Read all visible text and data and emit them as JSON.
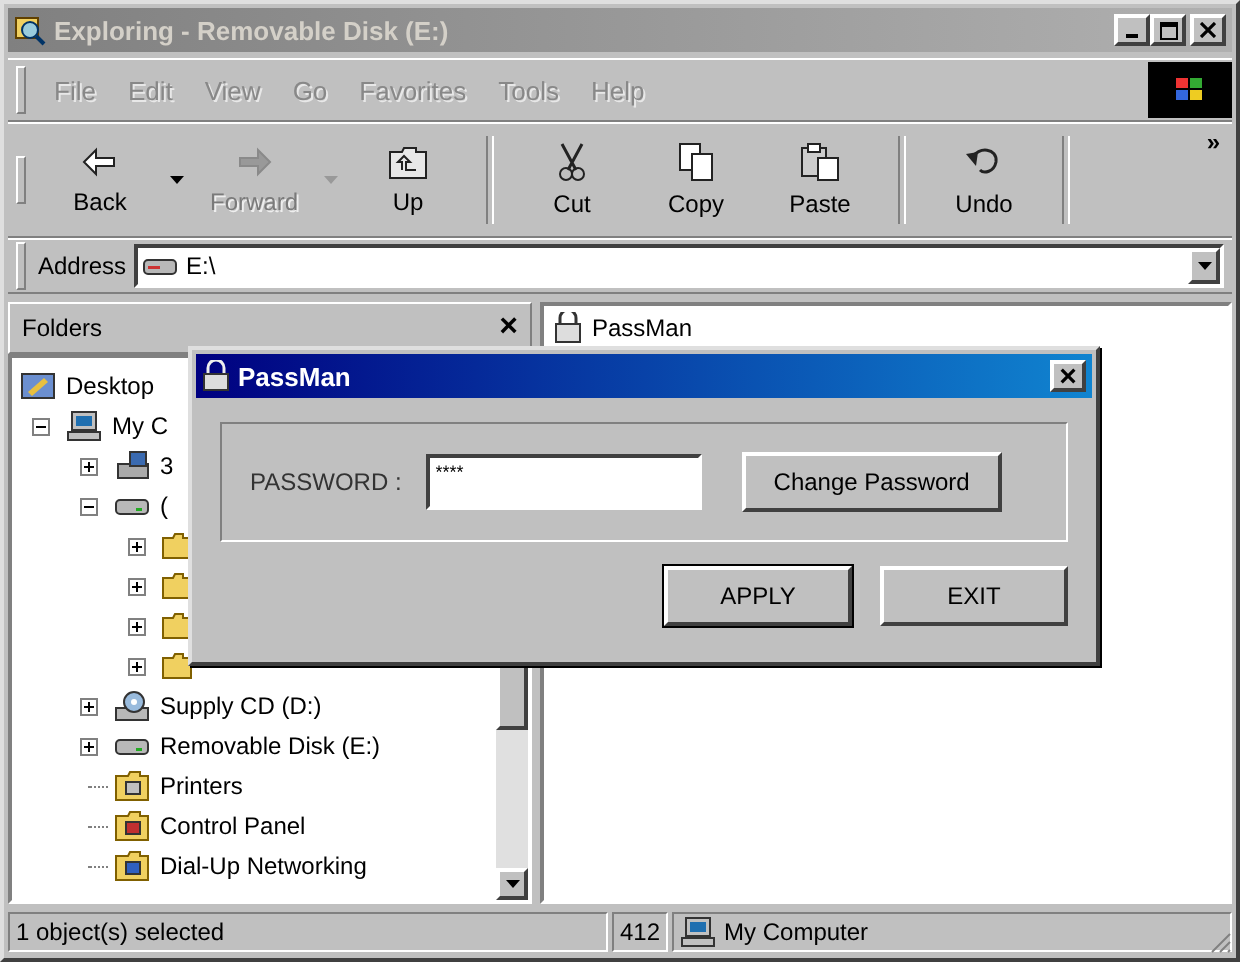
{
  "window": {
    "title": "Exploring - Removable Disk (E:)",
    "active": false
  },
  "menu": [
    {
      "label": "File"
    },
    {
      "label": "Edit"
    },
    {
      "label": "View"
    },
    {
      "label": "Go"
    },
    {
      "label": "Favorites"
    },
    {
      "label": "Tools"
    },
    {
      "label": "Help"
    }
  ],
  "toolbar": {
    "groups": [
      [
        {
          "kind": "back",
          "label": "Back",
          "disabled": false,
          "dropdown": true
        },
        {
          "kind": "forward",
          "label": "Forward",
          "disabled": true,
          "dropdown": true
        },
        {
          "kind": "up",
          "label": "Up",
          "disabled": false,
          "dropdown": false
        }
      ],
      [
        {
          "kind": "cut",
          "label": "Cut",
          "disabled": false,
          "dropdown": false
        },
        {
          "kind": "copy",
          "label": "Copy",
          "disabled": false,
          "dropdown": false
        },
        {
          "kind": "paste",
          "label": "Paste",
          "disabled": false,
          "dropdown": false
        }
      ],
      [
        {
          "kind": "undo",
          "label": "Undo",
          "disabled": false,
          "dropdown": false
        }
      ]
    ],
    "more": "»"
  },
  "address": {
    "label": "Address",
    "value": "E:\\"
  },
  "folders_pane": {
    "title": "Folders",
    "close": "×",
    "tree": [
      {
        "kind": "desktop",
        "label": "Desktop",
        "children": [
          {
            "kind": "computer",
            "label": "My C",
            "expanded": true,
            "children": [
              {
                "kind": "floppy",
                "label": "3",
                "expanded": false
              },
              {
                "kind": "drive",
                "label": "(",
                "expanded": true,
                "children": [
                  {
                    "kind": "folder",
                    "expanded": false
                  },
                  {
                    "kind": "folder",
                    "expanded": false
                  },
                  {
                    "kind": "folder",
                    "expanded": false
                  },
                  {
                    "kind": "folder",
                    "expanded": false
                  }
                ]
              },
              {
                "kind": "cdrom",
                "label": "Supply CD (D:)",
                "expanded": false
              },
              {
                "kind": "drive",
                "label": "Removable Disk (E:)",
                "expanded": false
              },
              {
                "kind": "printers",
                "label": "Printers"
              },
              {
                "kind": "control-panel",
                "label": "Control Panel"
              },
              {
                "kind": "network",
                "label": "Dial-Up Networking"
              }
            ]
          }
        ]
      }
    ]
  },
  "files": [
    {
      "name": "PassMan"
    }
  ],
  "status_bar": {
    "selection": "1 object(s) selected",
    "size": "412",
    "location": "My Computer"
  },
  "dialog": {
    "title": "PassMan",
    "active": true,
    "close": "×",
    "password_label": "PASSWORD :",
    "password_value": "****",
    "buttons": [
      {
        "label": "Change Password",
        "default": false
      },
      {
        "label": "APPLY",
        "default": true
      },
      {
        "label": "EXIT",
        "default": false
      }
    ]
  }
}
